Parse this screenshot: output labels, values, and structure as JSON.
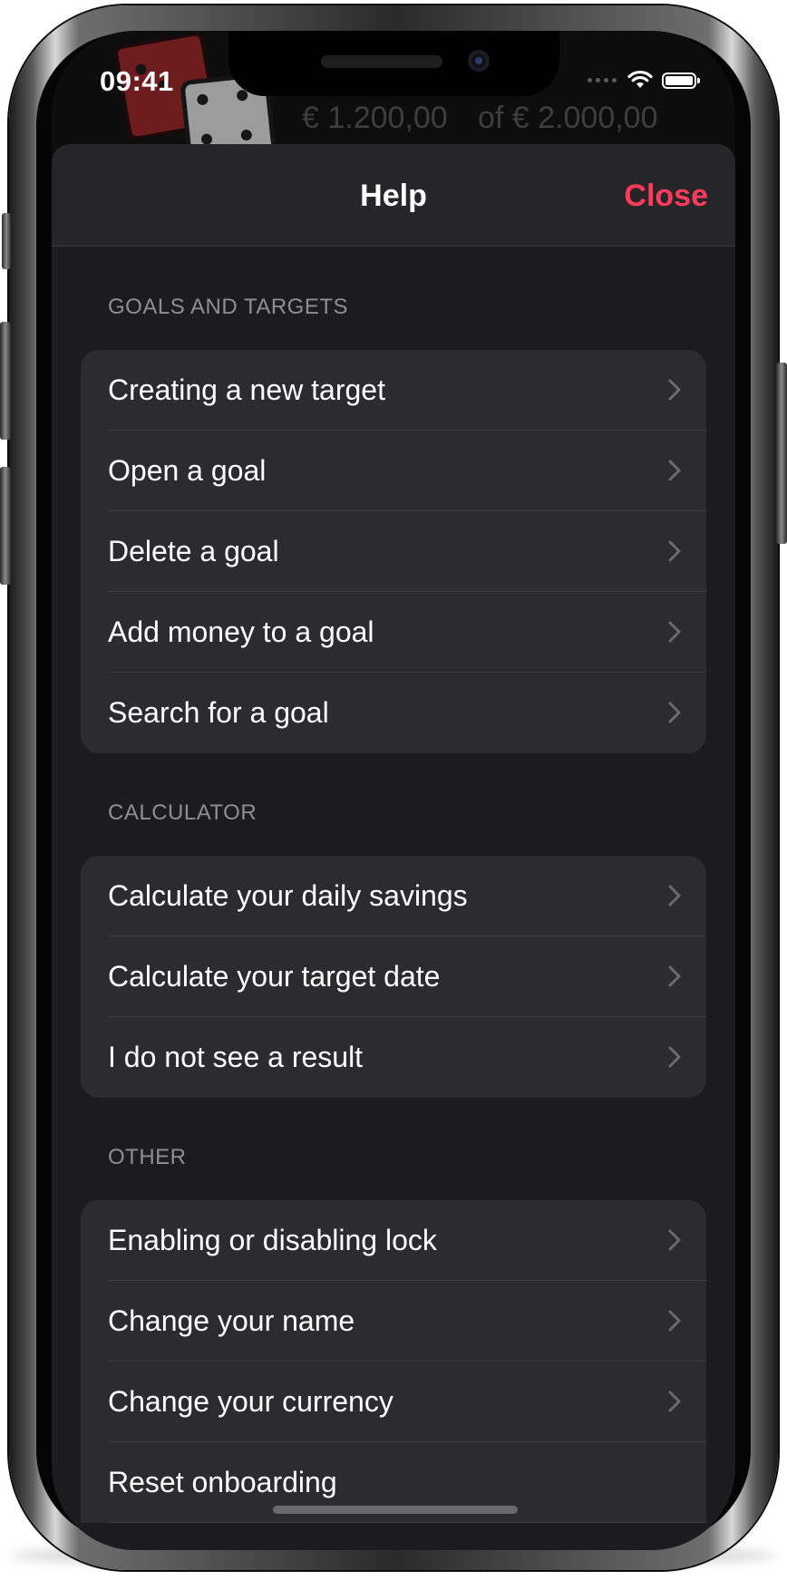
{
  "status_bar": {
    "time": "09:41"
  },
  "background_app": {
    "saved_amount": "€ 1.200,00",
    "target_amount": "of € 2.000,00"
  },
  "nav": {
    "title": "Help",
    "close_label": "Close"
  },
  "sections": [
    {
      "header": "GOALS AND TARGETS",
      "items": [
        {
          "label": "Creating a new target"
        },
        {
          "label": "Open a goal"
        },
        {
          "label": "Delete a goal"
        },
        {
          "label": "Add money to a goal"
        },
        {
          "label": "Search for a goal"
        }
      ]
    },
    {
      "header": "CALCULATOR",
      "items": [
        {
          "label": "Calculate your daily savings"
        },
        {
          "label": "Calculate your target date"
        },
        {
          "label": "I do not see a result"
        }
      ]
    },
    {
      "header": "OTHER",
      "items": [
        {
          "label": "Enabling or disabling lock"
        },
        {
          "label": "Change your name"
        },
        {
          "label": "Change your currency"
        },
        {
          "label": "Reset onboarding"
        }
      ]
    }
  ],
  "colors": {
    "accent": "#ff3b5c",
    "sheet_background": "#1c1c1e",
    "cell_background": "#2c2c2e",
    "section_header_text": "#8e8e93"
  },
  "icons": {
    "chevron": "chevron-right-icon",
    "wifi": "wifi-icon",
    "battery": "battery-icon",
    "dice": "dice-icon"
  }
}
